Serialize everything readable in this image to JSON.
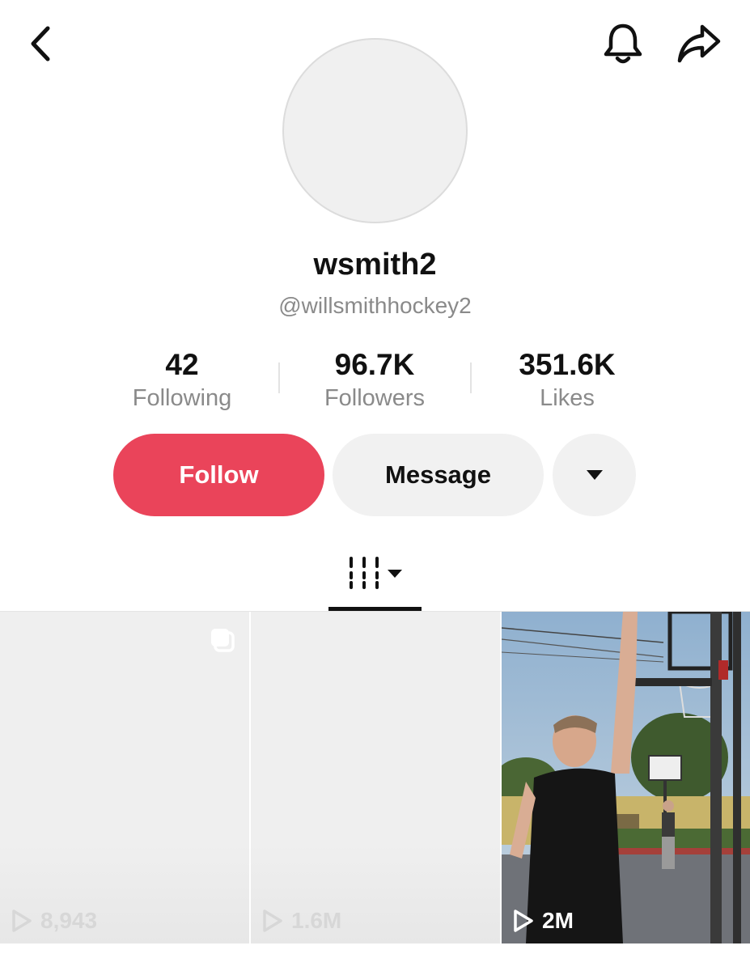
{
  "profile": {
    "display_name": "wsmith2",
    "username": "@willsmithhockey2"
  },
  "stats": {
    "following": {
      "value": "42",
      "label": "Following"
    },
    "followers": {
      "value": "96.7K",
      "label": "Followers"
    },
    "likes": {
      "value": "351.6K",
      "label": "Likes"
    }
  },
  "actions": {
    "follow_label": "Follow",
    "message_label": "Message"
  },
  "icons": {
    "back": "chevron-left-icon",
    "notifications": "bell-icon",
    "share": "share-arrow-icon",
    "more": "caret-down-icon",
    "videos_tab": "grid-lines-icon",
    "play": "play-icon",
    "multi": "stacked-squares-icon"
  },
  "colors": {
    "follow_button": "#ea445a",
    "secondary_button": "#f1f1f1",
    "muted_text": "#8a8a8a"
  },
  "videos": [
    {
      "views": "8,943"
    },
    {
      "views": "1.6M"
    },
    {
      "views": "2M"
    }
  ]
}
